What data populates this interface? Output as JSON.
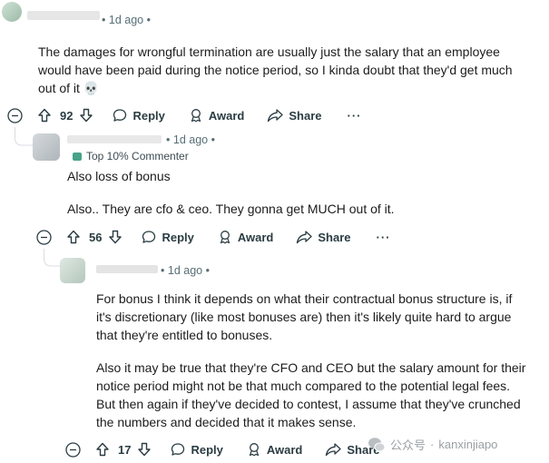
{
  "comments": [
    {
      "author_masked": "",
      "time": "1d ago",
      "body": [
        "The damages for wrongful termination are usually just the salary that an employee",
        "would have been paid during the notice period, so I kinda doubt that they'd get much",
        "out of it 💀"
      ],
      "votes": "92",
      "reply_label": "Reply",
      "award_label": "Award",
      "share_label": "Share",
      "more_label": "···"
    },
    {
      "author_masked": "",
      "time": "1d ago",
      "badge": "Top 10% Commenter",
      "body": [
        "Also loss of bonus",
        "Also.. They are cfo & ceo. They gonna get MUCH out of it."
      ],
      "votes": "56",
      "reply_label": "Reply",
      "award_label": "Award",
      "share_label": "Share",
      "more_label": "···"
    },
    {
      "author_masked": "",
      "time": "1d ago",
      "body": [
        "For bonus I think it depends on what their contractual bonus structure is, if it's discretionary (like most bonuses are) then it's likely quite hard to argue that they're entitled to bonuses.",
        "Also it may be true that they're CFO and CEO but the salary amount for their notice period might not be that much compared to the potential legal fees. But then again if they've decided to contest, I assume that they've crunched the numbers and decided that it makes sense."
      ],
      "votes": "17",
      "reply_label": "Reply",
      "award_label": "Award",
      "share_label": "Share"
    }
  ],
  "watermark": {
    "account": "公众号",
    "separator": "·",
    "name": "kanxinjiapo"
  },
  "separator_dot": "•",
  "colors": {
    "text": "#1c1c1c",
    "meta": "#576f76",
    "action": "#2a3c42",
    "thread_line": "#d8dde0",
    "badge_green": "#47a38a"
  }
}
